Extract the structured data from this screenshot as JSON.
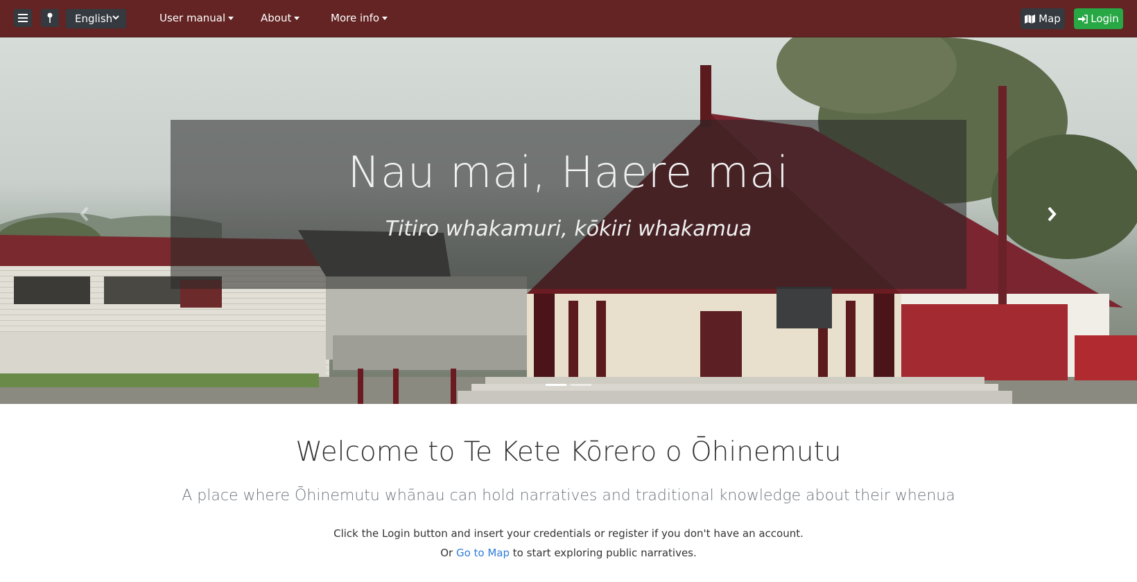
{
  "navbar": {
    "menu_icon": "hamburger-icon",
    "pin_icon": "map-pin-icon",
    "language": {
      "selected": "English"
    },
    "links": [
      {
        "label": "User manual"
      },
      {
        "label": "About"
      },
      {
        "label": "More info"
      }
    ],
    "map_button": {
      "label": "Map",
      "icon": "map-icon"
    },
    "login_button": {
      "label": "Login",
      "icon": "sign-in-icon"
    },
    "colors": {
      "background": "#632423",
      "login": "#28a745",
      "map": "#343a40"
    }
  },
  "hero": {
    "title": "Nau mai, Haere mai",
    "subtitle": "Titiro whakamuri, kōkiri whakamua",
    "prev_icon": "chevron-left-icon",
    "next_icon": "chevron-right-icon",
    "slides": 2,
    "active_slide": 1
  },
  "content": {
    "welcome": "Welcome to Te Kete Kōrero o Ōhinemutu",
    "lead": "A place where Ōhinemutu whānau can hold narratives and traditional knowledge about their whenua",
    "info_line1": "Click the Login button and insert your credentials or register if you don't have an account.",
    "info_or": "Or ",
    "go_to_map": "Go to Map",
    "info_after_link": " to start exploring public narratives.",
    "link_color": "#2f7bd8"
  }
}
